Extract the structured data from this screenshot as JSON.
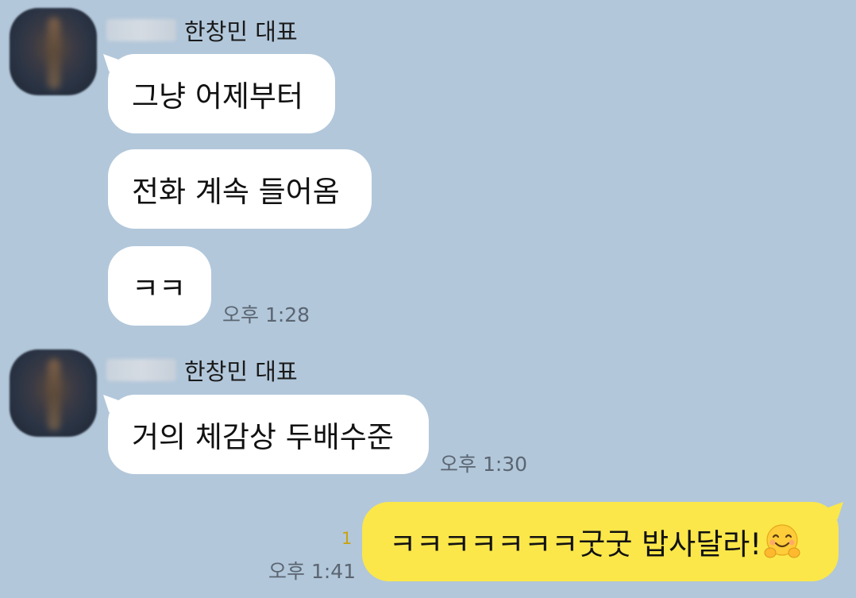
{
  "messages": [
    {
      "sender_name": "한창민 대표",
      "bubbles": [
        "그냥 어제부터",
        "전화 계속 들어옴",
        "ㅋㅋ"
      ],
      "time": "오후 1:28"
    },
    {
      "sender_name": "한창민 대표",
      "bubbles": [
        "거의 체감상 두배수준"
      ],
      "time": "오후 1:30"
    }
  ],
  "my_message": {
    "text": "ㅋㅋㅋㅋㅋㅋㅋ굿굿 밥사달라!",
    "emoji": "hugging-face-emoji",
    "unread_count": "1",
    "time": "오후 1:41"
  },
  "colors": {
    "background": "#b2c7da",
    "incoming_bubble": "#ffffff",
    "outgoing_bubble": "#fbe74a",
    "unread": "#c9a20c"
  }
}
